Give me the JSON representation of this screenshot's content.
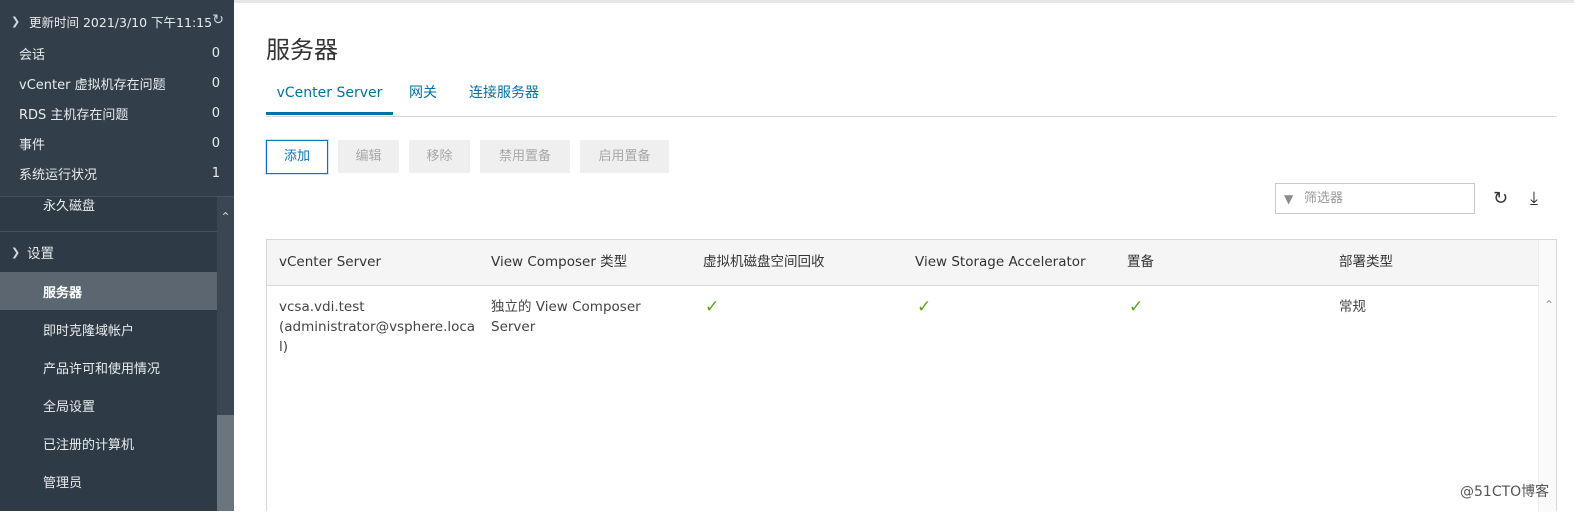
{
  "sidebar": {
    "update_label": "更新时间 2021/3/10 下午11:15",
    "stats": [
      {
        "label": "会话",
        "count": "0"
      },
      {
        "label": "vCenter 虚拟机存在问题",
        "count": "0"
      },
      {
        "label": "RDS 主机存在问题",
        "count": "0"
      },
      {
        "label": "事件",
        "count": "0"
      },
      {
        "label": "系统运行状况",
        "count": "1"
      }
    ],
    "prev_item": "永久磁盘",
    "section_label": "设置",
    "items": [
      {
        "label": "服务器",
        "active": true
      },
      {
        "label": "即时克隆域帐户"
      },
      {
        "label": "产品许可和使用情况"
      },
      {
        "label": "全局设置"
      },
      {
        "label": "已注册的计算机"
      },
      {
        "label": "管理员"
      }
    ],
    "scroll_fraction_top": 0.7
  },
  "page": {
    "title": "服务器",
    "tabs": [
      "vCenter Server",
      "网关",
      "连接服务器"
    ],
    "active_tab": "vCenter Server"
  },
  "toolbar": {
    "add": "添加",
    "edit": "编辑",
    "remove": "移除",
    "disable_provisioning": "禁用置备",
    "enable_provisioning": "启用置备"
  },
  "filter": {
    "placeholder": "筛选器"
  },
  "table": {
    "columns": [
      "vCenter Server",
      "View Composer 类型",
      "虚拟机磁盘空间回收",
      "View Storage Accelerator",
      "置备",
      "部署类型"
    ],
    "rows": [
      {
        "vcenter_line1": "vcsa.vdi.test",
        "vcenter_line2": "(administrator@vsphere.loca",
        "vcenter_line3": "l)",
        "composer_line1": "独立的 View Composer",
        "composer_line2": "Server",
        "disk_reclaim": "✓",
        "storage_accel": "✓",
        "provisioning": "✓",
        "deploy_type": "常规"
      }
    ]
  },
  "watermark": "@51CTO博客",
  "colors": {
    "accent": "#0072a3",
    "sidebar_bg": "#2e3a45",
    "check": "#5aa220"
  }
}
